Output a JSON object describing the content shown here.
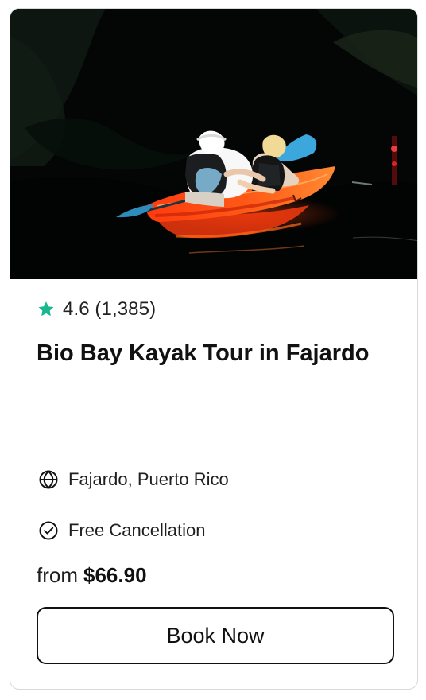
{
  "card": {
    "image_alt": "Two people paddling an orange kayak at night",
    "rating": {
      "icon": "star-icon",
      "text": "4.6 (1,385)",
      "color": "#17b890"
    },
    "title": "Bio Bay Kayak Tour in Fajardo",
    "features": [
      {
        "icon": "globe-icon",
        "text": "Fajardo, Puerto Rico"
      },
      {
        "icon": "check-circle-icon",
        "text": "Free Cancellation"
      }
    ],
    "price": {
      "prefix": "from",
      "value": "$66.90"
    },
    "button": {
      "label": "Book Now"
    }
  }
}
